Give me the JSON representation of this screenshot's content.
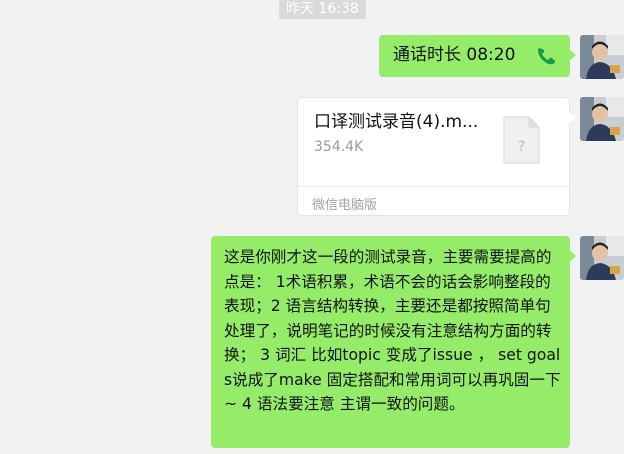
{
  "chat": {
    "timestamp": "昨天 16:38",
    "messages": [
      {
        "type": "call",
        "text": "通话时长 08:20",
        "icon": "phone-icon"
      },
      {
        "type": "file",
        "name": "口译测试录音(4).m...",
        "size": "354.4K",
        "source": "微信电脑版",
        "icon": "unknown-file-icon"
      },
      {
        "type": "text",
        "text": "这是你刚才这一段的测试录音，主要需要提高的点是： 1术语积累，术语不会的话会影响整段的表现；2 语言结构转换，主要还是都按照简单句处理了，说明笔记的时候没有注意结构方面的转换； 3 词汇 比如topic 变成了issue ， set goals说成了make   固定搭配和常用词可以再巩固一下~ 4 语法要注意 主谓一致的问题。"
      }
    ]
  },
  "colors": {
    "background": "#f2f2f2",
    "bubble_green": "#95ec69",
    "call_icon": "#1a9a4a",
    "muted_text": "#9a9a9a"
  }
}
